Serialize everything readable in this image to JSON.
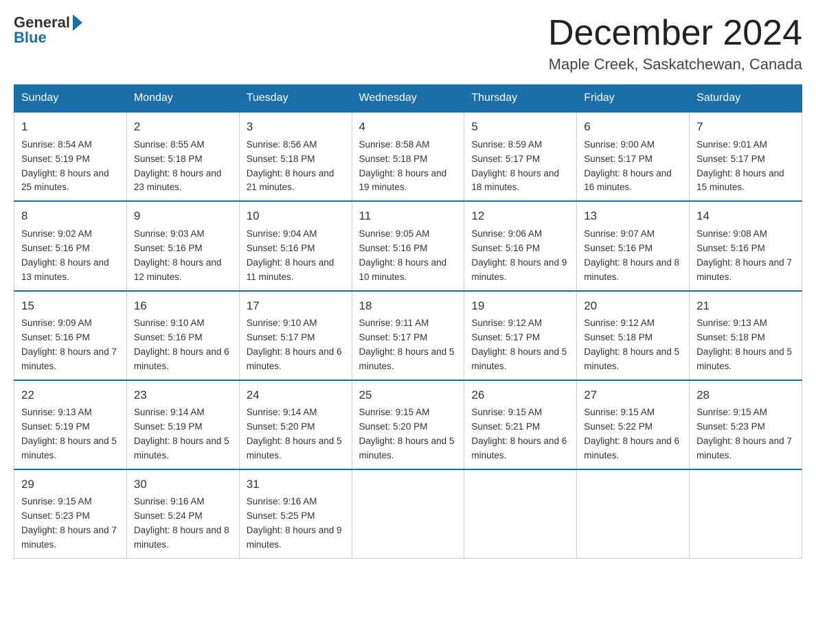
{
  "header": {
    "logo_general": "General",
    "logo_blue": "Blue",
    "month_title": "December 2024",
    "location": "Maple Creek, Saskatchewan, Canada"
  },
  "weekdays": [
    "Sunday",
    "Monday",
    "Tuesday",
    "Wednesday",
    "Thursday",
    "Friday",
    "Saturday"
  ],
  "weeks": [
    [
      {
        "day": 1,
        "sunrise": "8:54 AM",
        "sunset": "5:19 PM",
        "daylight": "8 hours and 25 minutes."
      },
      {
        "day": 2,
        "sunrise": "8:55 AM",
        "sunset": "5:18 PM",
        "daylight": "8 hours and 23 minutes."
      },
      {
        "day": 3,
        "sunrise": "8:56 AM",
        "sunset": "5:18 PM",
        "daylight": "8 hours and 21 minutes."
      },
      {
        "day": 4,
        "sunrise": "8:58 AM",
        "sunset": "5:18 PM",
        "daylight": "8 hours and 19 minutes."
      },
      {
        "day": 5,
        "sunrise": "8:59 AM",
        "sunset": "5:17 PM",
        "daylight": "8 hours and 18 minutes."
      },
      {
        "day": 6,
        "sunrise": "9:00 AM",
        "sunset": "5:17 PM",
        "daylight": "8 hours and 16 minutes."
      },
      {
        "day": 7,
        "sunrise": "9:01 AM",
        "sunset": "5:17 PM",
        "daylight": "8 hours and 15 minutes."
      }
    ],
    [
      {
        "day": 8,
        "sunrise": "9:02 AM",
        "sunset": "5:16 PM",
        "daylight": "8 hours and 13 minutes."
      },
      {
        "day": 9,
        "sunrise": "9:03 AM",
        "sunset": "5:16 PM",
        "daylight": "8 hours and 12 minutes."
      },
      {
        "day": 10,
        "sunrise": "9:04 AM",
        "sunset": "5:16 PM",
        "daylight": "8 hours and 11 minutes."
      },
      {
        "day": 11,
        "sunrise": "9:05 AM",
        "sunset": "5:16 PM",
        "daylight": "8 hours and 10 minutes."
      },
      {
        "day": 12,
        "sunrise": "9:06 AM",
        "sunset": "5:16 PM",
        "daylight": "8 hours and 9 minutes."
      },
      {
        "day": 13,
        "sunrise": "9:07 AM",
        "sunset": "5:16 PM",
        "daylight": "8 hours and 8 minutes."
      },
      {
        "day": 14,
        "sunrise": "9:08 AM",
        "sunset": "5:16 PM",
        "daylight": "8 hours and 7 minutes."
      }
    ],
    [
      {
        "day": 15,
        "sunrise": "9:09 AM",
        "sunset": "5:16 PM",
        "daylight": "8 hours and 7 minutes."
      },
      {
        "day": 16,
        "sunrise": "9:10 AM",
        "sunset": "5:16 PM",
        "daylight": "8 hours and 6 minutes."
      },
      {
        "day": 17,
        "sunrise": "9:10 AM",
        "sunset": "5:17 PM",
        "daylight": "8 hours and 6 minutes."
      },
      {
        "day": 18,
        "sunrise": "9:11 AM",
        "sunset": "5:17 PM",
        "daylight": "8 hours and 5 minutes."
      },
      {
        "day": 19,
        "sunrise": "9:12 AM",
        "sunset": "5:17 PM",
        "daylight": "8 hours and 5 minutes."
      },
      {
        "day": 20,
        "sunrise": "9:12 AM",
        "sunset": "5:18 PM",
        "daylight": "8 hours and 5 minutes."
      },
      {
        "day": 21,
        "sunrise": "9:13 AM",
        "sunset": "5:18 PM",
        "daylight": "8 hours and 5 minutes."
      }
    ],
    [
      {
        "day": 22,
        "sunrise": "9:13 AM",
        "sunset": "5:19 PM",
        "daylight": "8 hours and 5 minutes."
      },
      {
        "day": 23,
        "sunrise": "9:14 AM",
        "sunset": "5:19 PM",
        "daylight": "8 hours and 5 minutes."
      },
      {
        "day": 24,
        "sunrise": "9:14 AM",
        "sunset": "5:20 PM",
        "daylight": "8 hours and 5 minutes."
      },
      {
        "day": 25,
        "sunrise": "9:15 AM",
        "sunset": "5:20 PM",
        "daylight": "8 hours and 5 minutes."
      },
      {
        "day": 26,
        "sunrise": "9:15 AM",
        "sunset": "5:21 PM",
        "daylight": "8 hours and 6 minutes."
      },
      {
        "day": 27,
        "sunrise": "9:15 AM",
        "sunset": "5:22 PM",
        "daylight": "8 hours and 6 minutes."
      },
      {
        "day": 28,
        "sunrise": "9:15 AM",
        "sunset": "5:23 PM",
        "daylight": "8 hours and 7 minutes."
      }
    ],
    [
      {
        "day": 29,
        "sunrise": "9:15 AM",
        "sunset": "5:23 PM",
        "daylight": "8 hours and 7 minutes."
      },
      {
        "day": 30,
        "sunrise": "9:16 AM",
        "sunset": "5:24 PM",
        "daylight": "8 hours and 8 minutes."
      },
      {
        "day": 31,
        "sunrise": "9:16 AM",
        "sunset": "5:25 PM",
        "daylight": "8 hours and 9 minutes."
      },
      null,
      null,
      null,
      null
    ]
  ]
}
